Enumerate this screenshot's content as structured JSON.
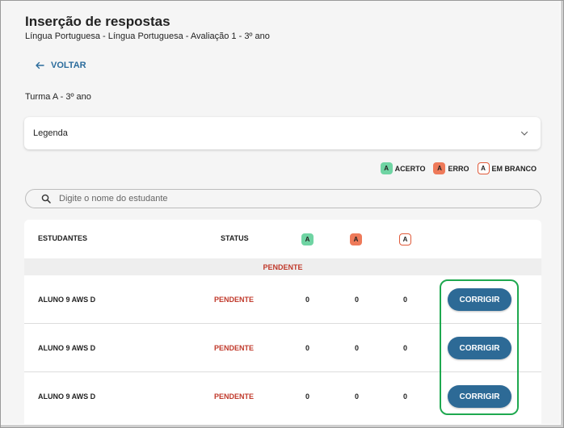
{
  "header": {
    "title": "Inserção de respostas",
    "subtitle": "Língua Portuguesa - Língua Portuguesa - Avaliação 1 - 3º ano"
  },
  "back_label": "VOLTAR",
  "class_label": "Turma A - 3º ano",
  "legend": {
    "label": "Legenda",
    "keys": [
      {
        "badge": "A",
        "label": "ACERTO",
        "color": "#6fd4a3"
      },
      {
        "badge": "A",
        "label": "ERRO",
        "color": "#ee7a5a"
      },
      {
        "badge": "A",
        "label": "EM BRANCO",
        "color": "#ffffff"
      }
    ]
  },
  "search": {
    "placeholder": "Digite o nome do estudante",
    "value": ""
  },
  "table": {
    "headers": {
      "students": "ESTUDANTES",
      "status": "STATUS",
      "correct_badge": "A",
      "wrong_badge": "A",
      "blank_badge": "A"
    },
    "section_label": "PENDENTE",
    "rows": [
      {
        "name": "ALUNO 9 AWS D",
        "status": "PENDENTE",
        "correct": "0",
        "wrong": "0",
        "blank": "0",
        "action": "CORRIGIR"
      },
      {
        "name": "ALUNO 9 AWS D",
        "status": "PENDENTE",
        "correct": "0",
        "wrong": "0",
        "blank": "0",
        "action": "CORRIGIR"
      },
      {
        "name": "ALUNO 9 AWS D",
        "status": "PENDENTE",
        "correct": "0",
        "wrong": "0",
        "blank": "0",
        "action": "CORRIGIR"
      }
    ]
  },
  "colors": {
    "accent": "#2d6a96",
    "pending": "#c0392b",
    "highlight": "#1ea84f"
  }
}
